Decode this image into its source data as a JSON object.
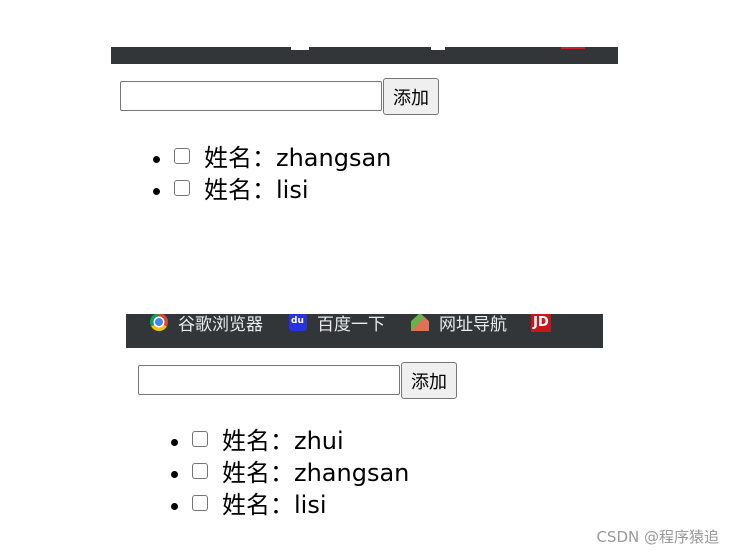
{
  "top_panel": {
    "input": {
      "value": "",
      "placeholder": ""
    },
    "add_button_label": "添加",
    "items": [
      {
        "label": "姓名：zhangsan",
        "checked": false
      },
      {
        "label": "姓名：lisi",
        "checked": false
      }
    ]
  },
  "bookmarks_bar": {
    "items": [
      {
        "label": "谷歌浏览器",
        "icon": "chrome-icon"
      },
      {
        "label": "百度一下",
        "icon": "baidu-icon"
      },
      {
        "label": "网址导航",
        "icon": "site-nav-icon"
      },
      {
        "label": "",
        "icon": "jd-icon",
        "badge": "JD"
      }
    ]
  },
  "bottom_panel": {
    "input": {
      "value": "",
      "placeholder": ""
    },
    "add_button_label": "添加",
    "items": [
      {
        "label": "姓名：zhui",
        "checked": false
      },
      {
        "label": "姓名：zhangsan",
        "checked": false
      },
      {
        "label": "姓名：lisi",
        "checked": false
      }
    ]
  },
  "watermark": "CSDN @程序猿追",
  "colors": {
    "browser_bar": "#323639",
    "button_bg": "#efefef",
    "border": "#767676",
    "watermark": "#999999"
  }
}
